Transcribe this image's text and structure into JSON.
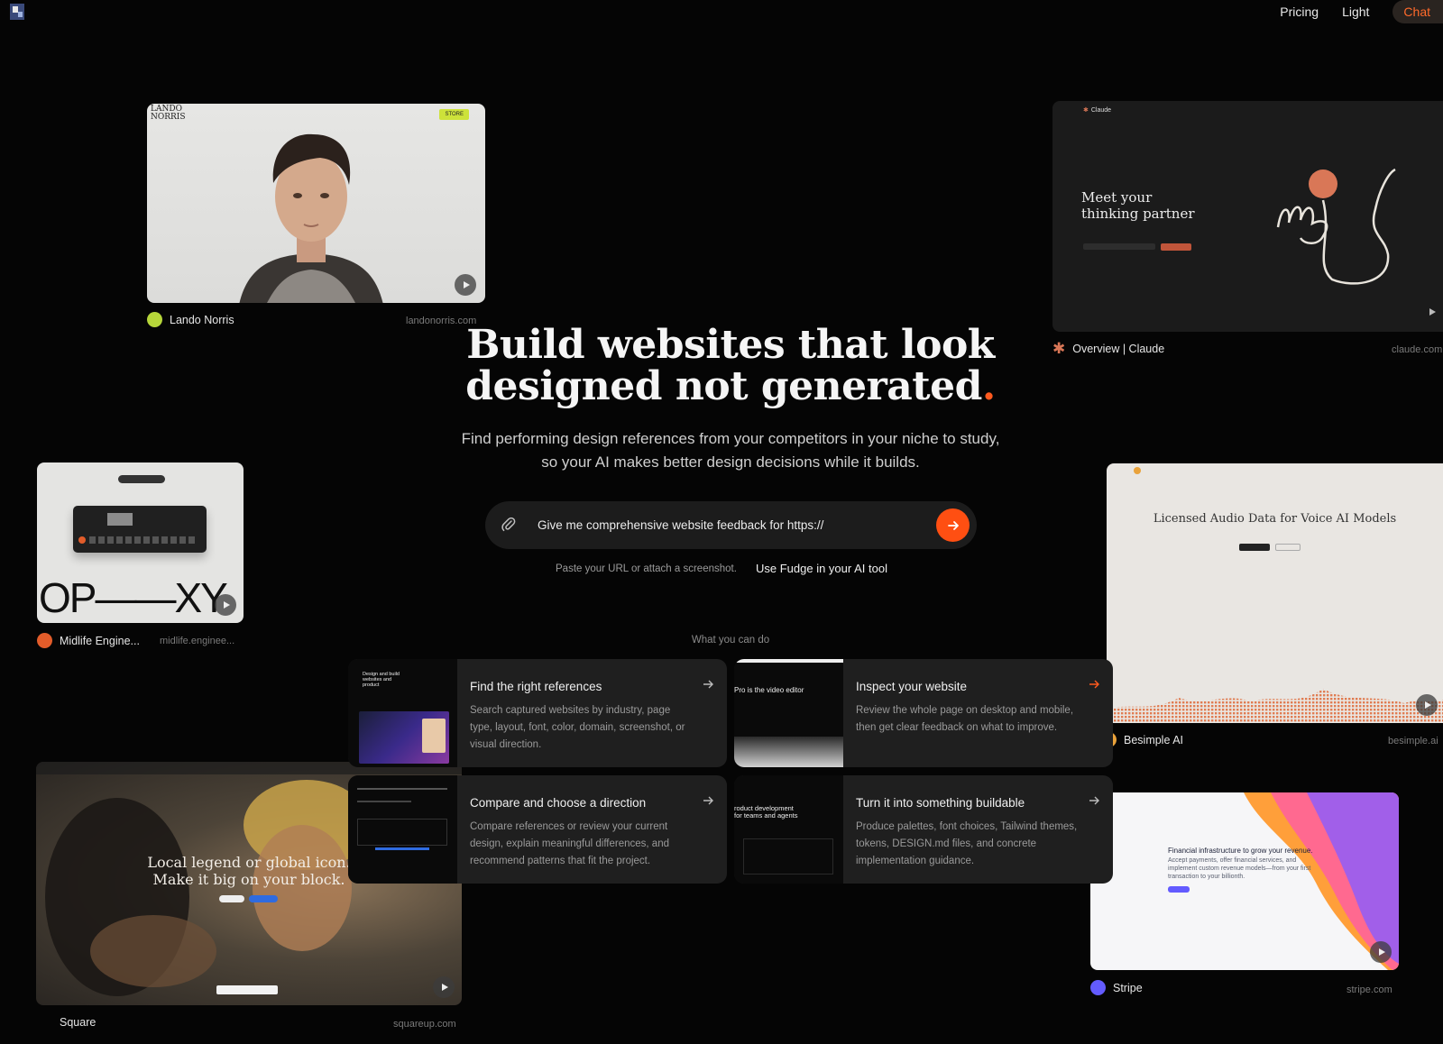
{
  "nav": {
    "pricing": "Pricing",
    "light": "Light",
    "chat": "Chat"
  },
  "hero": {
    "title_line1": "Build websites that look",
    "title_line2": "designed not generated",
    "title_dot": ".",
    "subtitle_line1": "Find performing design references from your competitors in your niche to study,",
    "subtitle_line2": "so your AI makes better design decisions while it builds."
  },
  "prompt": {
    "value": "Give me comprehensive website feedback for https://",
    "hint": "Paste your URL or attach a screenshot.",
    "tool_link": "Use Fudge in your AI tool"
  },
  "section_label": "What you can do",
  "features": [
    {
      "title": "Find the right references",
      "desc": "Search captured websites by industry, page type, layout, font, color, domain, screenshot, or visual direction."
    },
    {
      "title": "Inspect your website",
      "desc": "Review the whole page on desktop and mobile, then get clear feedback on what to improve."
    },
    {
      "title": "Compare and choose a direction",
      "desc": "Compare references or review your current design, explain meaningful differences, and recommend patterns that fit the project."
    },
    {
      "title": "Turn it into something buildable",
      "desc": "Produce palettes, font choices, Tailwind themes, tokens, DESIGN.md files, and concrete implementation guidance."
    }
  ],
  "references": {
    "lando": {
      "name": "Lando Norris",
      "domain": "landonorris.com",
      "logo_text_1": "LANDO",
      "logo_text_2": "NORRIS",
      "store_label": "STORE"
    },
    "claude": {
      "name": "Overview | Claude",
      "domain": "claude.com",
      "brand": "Claude",
      "headline_1": "Meet your",
      "headline_2": "thinking partner"
    },
    "midlife": {
      "name": "Midlife Engine...",
      "domain": "midlife.enginee...",
      "big_text": "OP——XY"
    },
    "besimple": {
      "name": "Besimple AI",
      "domain": "besimple.ai",
      "headline": "Licensed Audio Data for Voice AI Models"
    },
    "square": {
      "name": "Square",
      "domain": "squareup.com",
      "headline_1": "Local legend or global icon.",
      "headline_2": "Make it big on your block."
    },
    "stripe": {
      "name": "Stripe",
      "domain": "stripe.com",
      "headline_1": "Financial infrastructure to grow your revenue.",
      "body": "Accept payments, offer financial services, and implement custom revenue models—from your first transaction to your billionth."
    }
  },
  "thumbs": {
    "video_editor": "Pro is the video editor",
    "product_dev_1": "roduct development",
    "product_dev_2": "for teams and agents",
    "design_thumb": "Design and build websites and product"
  },
  "colors": {
    "accent": "#ff4f12",
    "card_bg": "#1f1f1f",
    "page_bg": "#050505"
  }
}
